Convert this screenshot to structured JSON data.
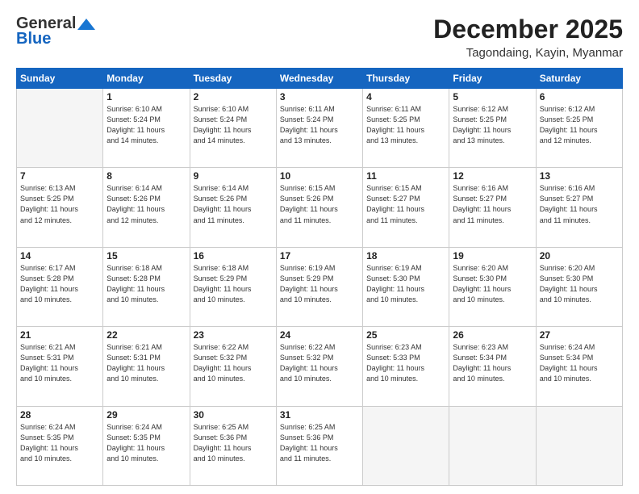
{
  "logo": {
    "line1": "General",
    "line2": "Blue"
  },
  "header": {
    "month_year": "December 2025",
    "location": "Tagondaing, Kayin, Myanmar"
  },
  "days_of_week": [
    "Sunday",
    "Monday",
    "Tuesday",
    "Wednesday",
    "Thursday",
    "Friday",
    "Saturday"
  ],
  "weeks": [
    [
      {
        "day": "",
        "info": ""
      },
      {
        "day": "1",
        "info": "Sunrise: 6:10 AM\nSunset: 5:24 PM\nDaylight: 11 hours\nand 14 minutes."
      },
      {
        "day": "2",
        "info": "Sunrise: 6:10 AM\nSunset: 5:24 PM\nDaylight: 11 hours\nand 14 minutes."
      },
      {
        "day": "3",
        "info": "Sunrise: 6:11 AM\nSunset: 5:24 PM\nDaylight: 11 hours\nand 13 minutes."
      },
      {
        "day": "4",
        "info": "Sunrise: 6:11 AM\nSunset: 5:25 PM\nDaylight: 11 hours\nand 13 minutes."
      },
      {
        "day": "5",
        "info": "Sunrise: 6:12 AM\nSunset: 5:25 PM\nDaylight: 11 hours\nand 13 minutes."
      },
      {
        "day": "6",
        "info": "Sunrise: 6:12 AM\nSunset: 5:25 PM\nDaylight: 11 hours\nand 12 minutes."
      }
    ],
    [
      {
        "day": "7",
        "info": "Sunrise: 6:13 AM\nSunset: 5:25 PM\nDaylight: 11 hours\nand 12 minutes."
      },
      {
        "day": "8",
        "info": "Sunrise: 6:14 AM\nSunset: 5:26 PM\nDaylight: 11 hours\nand 12 minutes."
      },
      {
        "day": "9",
        "info": "Sunrise: 6:14 AM\nSunset: 5:26 PM\nDaylight: 11 hours\nand 11 minutes."
      },
      {
        "day": "10",
        "info": "Sunrise: 6:15 AM\nSunset: 5:26 PM\nDaylight: 11 hours\nand 11 minutes."
      },
      {
        "day": "11",
        "info": "Sunrise: 6:15 AM\nSunset: 5:27 PM\nDaylight: 11 hours\nand 11 minutes."
      },
      {
        "day": "12",
        "info": "Sunrise: 6:16 AM\nSunset: 5:27 PM\nDaylight: 11 hours\nand 11 minutes."
      },
      {
        "day": "13",
        "info": "Sunrise: 6:16 AM\nSunset: 5:27 PM\nDaylight: 11 hours\nand 11 minutes."
      }
    ],
    [
      {
        "day": "14",
        "info": "Sunrise: 6:17 AM\nSunset: 5:28 PM\nDaylight: 11 hours\nand 10 minutes."
      },
      {
        "day": "15",
        "info": "Sunrise: 6:18 AM\nSunset: 5:28 PM\nDaylight: 11 hours\nand 10 minutes."
      },
      {
        "day": "16",
        "info": "Sunrise: 6:18 AM\nSunset: 5:29 PM\nDaylight: 11 hours\nand 10 minutes."
      },
      {
        "day": "17",
        "info": "Sunrise: 6:19 AM\nSunset: 5:29 PM\nDaylight: 11 hours\nand 10 minutes."
      },
      {
        "day": "18",
        "info": "Sunrise: 6:19 AM\nSunset: 5:30 PM\nDaylight: 11 hours\nand 10 minutes."
      },
      {
        "day": "19",
        "info": "Sunrise: 6:20 AM\nSunset: 5:30 PM\nDaylight: 11 hours\nand 10 minutes."
      },
      {
        "day": "20",
        "info": "Sunrise: 6:20 AM\nSunset: 5:30 PM\nDaylight: 11 hours\nand 10 minutes."
      }
    ],
    [
      {
        "day": "21",
        "info": "Sunrise: 6:21 AM\nSunset: 5:31 PM\nDaylight: 11 hours\nand 10 minutes."
      },
      {
        "day": "22",
        "info": "Sunrise: 6:21 AM\nSunset: 5:31 PM\nDaylight: 11 hours\nand 10 minutes."
      },
      {
        "day": "23",
        "info": "Sunrise: 6:22 AM\nSunset: 5:32 PM\nDaylight: 11 hours\nand 10 minutes."
      },
      {
        "day": "24",
        "info": "Sunrise: 6:22 AM\nSunset: 5:32 PM\nDaylight: 11 hours\nand 10 minutes."
      },
      {
        "day": "25",
        "info": "Sunrise: 6:23 AM\nSunset: 5:33 PM\nDaylight: 11 hours\nand 10 minutes."
      },
      {
        "day": "26",
        "info": "Sunrise: 6:23 AM\nSunset: 5:34 PM\nDaylight: 11 hours\nand 10 minutes."
      },
      {
        "day": "27",
        "info": "Sunrise: 6:24 AM\nSunset: 5:34 PM\nDaylight: 11 hours\nand 10 minutes."
      }
    ],
    [
      {
        "day": "28",
        "info": "Sunrise: 6:24 AM\nSunset: 5:35 PM\nDaylight: 11 hours\nand 10 minutes."
      },
      {
        "day": "29",
        "info": "Sunrise: 6:24 AM\nSunset: 5:35 PM\nDaylight: 11 hours\nand 10 minutes."
      },
      {
        "day": "30",
        "info": "Sunrise: 6:25 AM\nSunset: 5:36 PM\nDaylight: 11 hours\nand 10 minutes."
      },
      {
        "day": "31",
        "info": "Sunrise: 6:25 AM\nSunset: 5:36 PM\nDaylight: 11 hours\nand 11 minutes."
      },
      {
        "day": "",
        "info": ""
      },
      {
        "day": "",
        "info": ""
      },
      {
        "day": "",
        "info": ""
      }
    ]
  ]
}
